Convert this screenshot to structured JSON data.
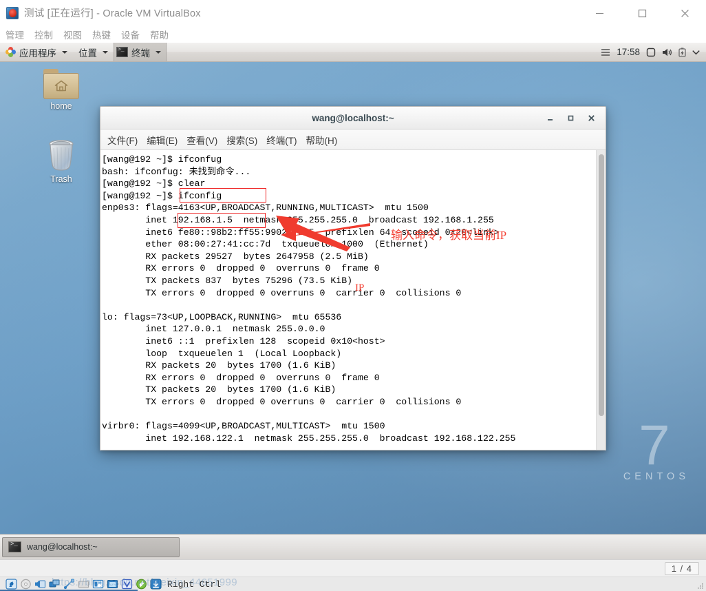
{
  "vbox": {
    "title": "测试 [正在运行] - Oracle VM VirtualBox",
    "app_icon": "virtualbox-icon",
    "window_buttons": [
      {
        "name": "minimize-button",
        "glyph": "minimize-icon"
      },
      {
        "name": "maximize-button",
        "glyph": "maximize-icon"
      },
      {
        "name": "close-button",
        "glyph": "close-icon"
      }
    ],
    "menus": [
      "管理",
      "控制",
      "视图",
      "热键",
      "设备",
      "帮助"
    ],
    "statusbar": {
      "page_count": "1 / 4",
      "host_key": "Right Ctrl",
      "watermark": "https://blog.csdn.net/weixin_44651999",
      "icons": [
        "hard-disk-icon",
        "optical-disk-icon",
        "audio-icon",
        "network-icon",
        "usb-icon",
        "shared-folder-icon",
        "display-icon",
        "recording-icon",
        "virtualization-icon",
        "mouse-integration-icon",
        "host-key-icon"
      ]
    }
  },
  "guest": {
    "panel": {
      "applications": "应用程序",
      "places": "位置",
      "terminal": "终端",
      "clock": "17:58",
      "icons": [
        "hamburger-icon",
        "screen-icon",
        "volume-icon",
        "battery-icon",
        "chevron-down-icon"
      ]
    },
    "desktop_icons": [
      {
        "name": "home",
        "label": "home",
        "icon": "folder-home-icon"
      },
      {
        "name": "trash",
        "label": "Trash",
        "icon": "trash-icon"
      }
    ],
    "watermark": {
      "number": "7",
      "word": "CENTOS"
    },
    "taskbar": {
      "window_label": "wang@localhost:~",
      "icon": "terminal-icon"
    }
  },
  "terminal": {
    "title": "wang@localhost:~",
    "window_buttons": [
      {
        "name": "minimize-button",
        "glyph": "minimize-icon"
      },
      {
        "name": "maximize-button",
        "glyph": "maximize-icon"
      },
      {
        "name": "close-button",
        "glyph": "close-icon"
      }
    ],
    "menus": [
      "文件(F)",
      "编辑(E)",
      "查看(V)",
      "搜索(S)",
      "终端(T)",
      "帮助(H)"
    ],
    "lines": [
      "[wang@192 ~]$ ifconfug",
      "bash: ifconfug: 未找到命令...",
      "[wang@192 ~]$ clear",
      "[wang@192 ~]$ ifconfig",
      "enp0s3: flags=4163<UP,BROADCAST,RUNNING,MULTICAST>  mtu 1500",
      "        inet 192.168.1.5  netmask 255.255.255.0  broadcast 192.168.1.255",
      "        inet6 fe80::98b2:ff55:9902:78c5  prefixlen 64  scopeid 0x20<link>",
      "        ether 08:00:27:41:cc:7d  txqueuelen 1000  (Ethernet)",
      "        RX packets 29527  bytes 2647958 (2.5 MiB)",
      "        RX errors 0  dropped 0  overruns 0  frame 0",
      "        TX packets 837  bytes 75296 (73.5 KiB)",
      "        TX errors 0  dropped 0 overruns 0  carrier 0  collisions 0",
      "",
      "lo: flags=73<UP,LOOPBACK,RUNNING>  mtu 65536",
      "        inet 127.0.0.1  netmask 255.0.0.0",
      "        inet6 ::1  prefixlen 128  scopeid 0x10<host>",
      "        loop  txqueuelen 1  (Local Loopback)",
      "        RX packets 20  bytes 1700 (1.6 KiB)",
      "        RX errors 0  dropped 0  overruns 0  frame 0",
      "        TX packets 20  bytes 1700 (1.6 KiB)",
      "        TX errors 0  dropped 0 overruns 0  carrier 0  collisions 0",
      "",
      "virbr0: flags=4099<UP,BROADCAST,MULTICAST>  mtu 1500",
      "        inet 192.168.122.1  netmask 255.255.255.0  broadcast 192.168.122.255"
    ]
  },
  "annotations": {
    "note_command": "输入命令，获取当前IP",
    "note_ip": "IP",
    "box_color": "#ee2222",
    "text_color": "#f44336"
  }
}
